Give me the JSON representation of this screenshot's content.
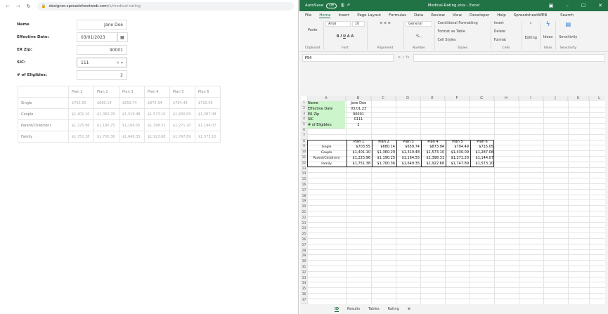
{
  "browser": {
    "url_host": "designer.spreadsheetweb.com",
    "url_path": "/s/medical-rating"
  },
  "form": {
    "name": {
      "label": "Name",
      "value": "Jane Doe"
    },
    "date": {
      "label": "Effective Date:",
      "value": "03/01/2023"
    },
    "zip": {
      "label": "ER Zip:",
      "value": "90001"
    },
    "sic": {
      "label": "SIC:",
      "value": "111"
    },
    "eligibles": {
      "label": "# of Eligibles:",
      "value": "2"
    }
  },
  "rates": {
    "headers": [
      "",
      "Plan 1",
      "Plan 2",
      "Plan 3",
      "Plan 4",
      "Plan 5",
      "Plan 6"
    ],
    "rows": [
      {
        "label": "Single",
        "values": [
          "$703.55",
          "$680.14",
          "$659.74",
          "$873.94",
          "$794.49",
          "$715.05"
        ]
      },
      {
        "label": "Couple",
        "values": [
          "$1,401.10",
          "$1,360.29",
          "$1,319.48",
          "$1,573.10",
          "$1,430.09",
          "$1,287.08"
        ]
      },
      {
        "label": "Parent/Child(ren)",
        "values": [
          "$1,225.96",
          "$1,190.25",
          "$1,164.55",
          "$1,398.31",
          "$1,271.20",
          "$1,144.07"
        ]
      },
      {
        "label": "Family",
        "values": [
          "$1,751.38",
          "$1,700.36",
          "$1,649.35",
          "$1,922.68",
          "$1,747.89",
          "$1,573.10"
        ]
      }
    ]
  },
  "excel": {
    "autosave": "AutoSave",
    "autosave_state": "Off",
    "title": "Medical-Rating.xlsx - Excel",
    "menu": [
      "File",
      "Home",
      "Insert",
      "Page Layout",
      "Formulas",
      "Data",
      "Review",
      "View",
      "Developer",
      "Help",
      "SpreadsheetWEB"
    ],
    "search": "Search",
    "ribbon": {
      "clipboard": "Clipboard",
      "paste": "Paste",
      "font": "Font",
      "font_name": "Arial",
      "font_size": "10",
      "alignment": "Alignment",
      "number": "Number",
      "number_format": "General",
      "cond": "Conditional Formatting",
      "fmt_table": "Format as Table",
      "cell_styles": "Cell Styles",
      "styles": "Styles",
      "insert": "Insert",
      "delete": "Delete",
      "format": "Format",
      "cells": "Cells",
      "editing": "Editing",
      "ideas": "Ideas",
      "sensitivity": "Sensitivity"
    },
    "name_box": "F54",
    "columns": [
      "A",
      "B",
      "C",
      "D",
      "E",
      "F",
      "G",
      "H",
      "I",
      "J",
      "K",
      "L"
    ],
    "inputs": [
      [
        "Name",
        "Jane Doe"
      ],
      [
        "Effective Date",
        "03.01.23"
      ],
      [
        "ER Zip",
        "90001"
      ],
      [
        "SIC",
        "0111"
      ],
      [
        "# of Eligibles:",
        "2"
      ]
    ],
    "sheets": [
      "ID",
      "Results",
      "Tables",
      "Rating"
    ],
    "input_fill": "#ccf5cc",
    "accent": "#217346"
  }
}
